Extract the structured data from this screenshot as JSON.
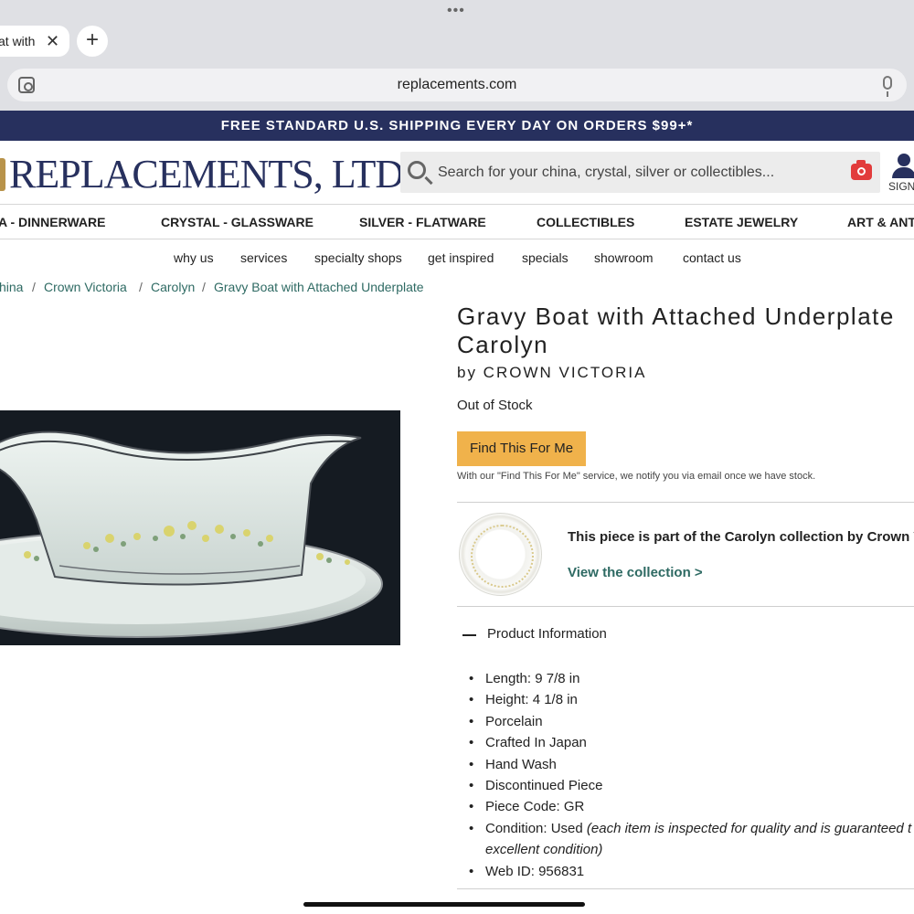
{
  "browser": {
    "tab_title": "at with",
    "tab_close": "✕",
    "new_tab": "+",
    "dots": "•••",
    "url": "replacements.com"
  },
  "promo": "FREE STANDARD U.S. SHIPPING EVERY DAY ON ORDERS $99+*",
  "header": {
    "logo_text": "REPLACEMENTS, LTD.",
    "search_placeholder": "Search for your china, crystal, silver or collectibles...",
    "sign_in": "SIGN"
  },
  "category_nav": [
    "A - DINNERWARE",
    "CRYSTAL - GLASSWARE",
    "SILVER - FLATWARE",
    "COLLECTIBLES",
    "ESTATE JEWELRY",
    "ART & ANTI"
  ],
  "sub_nav": [
    "why us",
    "services",
    "specialty shops",
    "get inspired",
    "specials",
    "showroom",
    "contact us"
  ],
  "breadcrumb": [
    "hina",
    "Crown Victoria",
    "Carolyn",
    "Gravy Boat with Attached Underplate"
  ],
  "product": {
    "title_line1": "Gravy Boat with Attached Underplate",
    "title_line2": "Carolyn",
    "by": "by CROWN VICTORIA",
    "stock": "Out of Stock",
    "find_button": "Find This For Me",
    "find_note": "With our \"Find This For Me\" service, we notify you via email once we have stock.",
    "collection_text": "This piece is part of the Carolyn collection by Crown Vic",
    "collection_link": "View the collection >",
    "info_title": "Product Information",
    "specs": [
      "Length: 9 7/8 in",
      "Height: 4 1/8 in",
      "Porcelain",
      "Crafted In Japan",
      "Hand Wash",
      "Discontinued Piece",
      "Piece Code: GR"
    ],
    "condition_label": "Condition: Used ",
    "condition_note_line1": "(each item is inspected for quality and is guaranteed t",
    "condition_note_line2": "excellent condition)",
    "web_id": "Web ID: 956831"
  },
  "colors": {
    "navy": "#27305e",
    "teal_link": "#2e6a63",
    "button_orange": "#f0b24b",
    "camera_red": "#e23c3c"
  }
}
